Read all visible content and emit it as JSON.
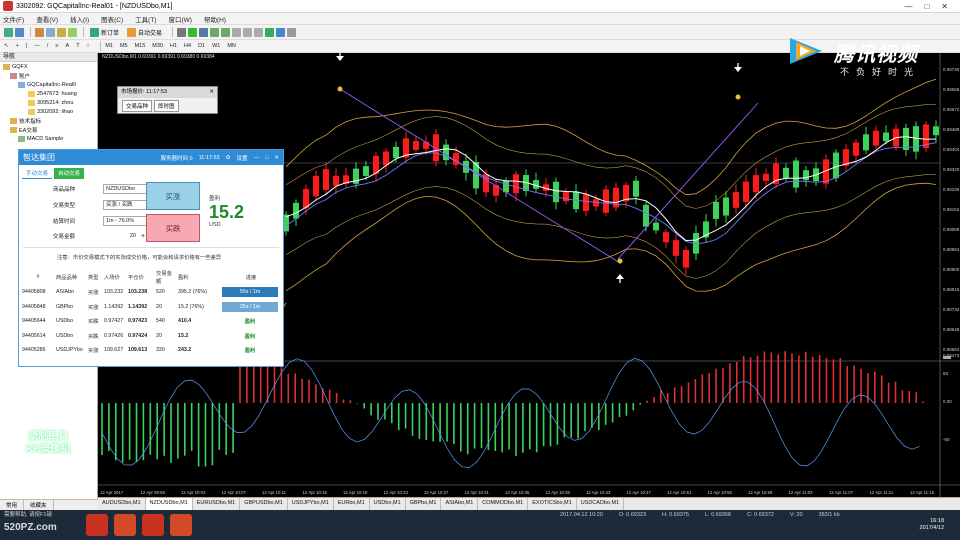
{
  "window": {
    "title": "3302092: GQCapitalInc-Real01 - [NZDUSDbo,M1]",
    "controls": [
      "—",
      "□",
      "✕"
    ]
  },
  "menu": [
    "文件(F)",
    "查看(V)",
    "插入(I)",
    "图表(C)",
    "工具(T)",
    "窗口(W)",
    "帮助(H)"
  ],
  "toolbar": {
    "new_order": "新订单",
    "auto_trade": "自动交易",
    "timeframes": [
      "M1",
      "M5",
      "M15",
      "M30",
      "H1",
      "H4",
      "D1",
      "W1",
      "MN"
    ]
  },
  "navigator": {
    "title": "导航",
    "root": "GQFX",
    "items": [
      "账户",
      "GQCapitalInc-Real0",
      "2547673: huang",
      "3095214: zhou",
      "3302092: lihao",
      "技术指标",
      "EA交易",
      "MACD Sample"
    ],
    "tabs": [
      "常用",
      "收藏夹"
    ]
  },
  "chart": {
    "info": "NZDUSDbo,M1  0.69391 0.69391 0.69380 0.69384",
    "price_labels": [
      "0.69740",
      "0.69656",
      "0.69572",
      "0.69488",
      "0.69404",
      "0.69320",
      "0.69236",
      "0.69152",
      "0.69068",
      "0.68984",
      "0.68900",
      "0.68816",
      "0.68732",
      "0.68648",
      "0.68564"
    ],
    "current_price": "0.69384",
    "indicator_labels": [
      "0.68473",
      "83",
      "0.00",
      "-60"
    ],
    "time_labels": [
      "12 Apr 2017",
      "12 Apr 09:59",
      "12 Apr 10:03",
      "12 Apr 10:07",
      "12 Apr 10:11",
      "12 Apr 10:15",
      "12 Apr 10:19",
      "12 Apr 10:23",
      "12 Apr 10:27",
      "12 Apr 10:31",
      "12 Apr 10:35",
      "12 Apr 10:39",
      "12 Apr 10:43",
      "12 Apr 10:47",
      "12 Apr 10:51",
      "12 Apr 10:55",
      "12 Apr 10:59",
      "12 Apr 11:03",
      "12 Apr 11:07",
      "12 Apr 11:11",
      "12 Apr 11:15"
    ]
  },
  "mini_window": {
    "title": "市场报价: 11:17:53",
    "btn1": "交易品种",
    "btn2": "即时图"
  },
  "trade_panel": {
    "title": "智达集团",
    "server_time_label": "服务器时间 0",
    "server_time": "11:17:53",
    "settings": "设置",
    "tab_manual": "手动交易",
    "tab_auto": "自动交易",
    "symbol_label": "商品品种",
    "symbol_value": "NZDUSDbo",
    "type_label": "交易类型",
    "type_value": "买涨 / 买跌",
    "time_label": "结算时间",
    "time_value": "1m - 76.0%",
    "amount_label": "交易金额",
    "amount_value": "20",
    "btn_up": "买涨",
    "btn_down": "买跌",
    "profit_label": "盈利",
    "profit_value": "15.2",
    "profit_unit": "USD",
    "note": "注意：市价交易模式下的实际成交价格，可能会和请求价格有一些差异",
    "columns": [
      "#",
      "商品品种",
      "类型",
      "入场价",
      "平仓价",
      "交易金额",
      "盈利",
      "进度"
    ],
    "rows": [
      {
        "id": "94405808",
        "symbol": "ASIAbo",
        "type": "买涨",
        "entry": "103.232",
        "close": "103.238",
        "amount": "520",
        "profit": "395.2 (76%)",
        "progress": "55s / 1m"
      },
      {
        "id": "94405848",
        "symbol": "GBPbo",
        "type": "买涨",
        "entry": "1.14392",
        "close": "1.14392",
        "amount": "20",
        "profit": "15.2 (76%)",
        "progress": "25s / 1m"
      },
      {
        "id": "94405644",
        "symbol": "USDbo",
        "type": "买跌",
        "entry": "0.97427",
        "close": "0.97423",
        "amount": "540",
        "profit": "410.4",
        "progress": "盈利"
      },
      {
        "id": "94405614",
        "symbol": "USDbo",
        "type": "买跌",
        "entry": "0.97426",
        "close": "0.97424",
        "amount": "20",
        "profit": "15.2",
        "progress": "盈利"
      },
      {
        "id": "94405286",
        "symbol": "USDJPYbo",
        "type": "买涨",
        "entry": "109.627",
        "close": "109.613",
        "amount": "320",
        "profit": "243.2",
        "progress": "盈利"
      }
    ]
  },
  "symbol_tabs": [
    "AUDUSDbo,M1",
    "NZDUSDbo,M1",
    "EURUSDbo,M1",
    "GBPUSDbo,M1",
    "USDJPYbo,M1",
    "EURbo,M1",
    "USDbo,M1",
    "GBPbo,M1",
    "ASIAbo,M1",
    "COMMODbo,M1",
    "EXOTICSbo,M1",
    "USDCADbo,M1"
  ],
  "status": {
    "help": "需要帮助, 请按F1键",
    "time": "2017.04.12 10:20",
    "open": "O: 0.69323",
    "high": "H: 0.69375",
    "low": "L: 0.69368",
    "close": "C: 0.69372",
    "volume": "V: 20",
    "traffic": "383/1 kb"
  },
  "clock": {
    "time": "16:18",
    "date": "2017/4/12"
  },
  "watermarks": {
    "brand": "腾讯视频",
    "slogan": "不负好时光",
    "recorder": "录制工具\nKK录像机",
    "site": "520PZ.com"
  },
  "colors": {
    "bull": "#3dd35a",
    "bear": "#ff1a1a",
    "band": "#d8a040",
    "ma_white": "#ffffff",
    "ma_blue": "#6e7bff",
    "zigzag": "#9b5cff",
    "accent": "#2e8bd6"
  }
}
